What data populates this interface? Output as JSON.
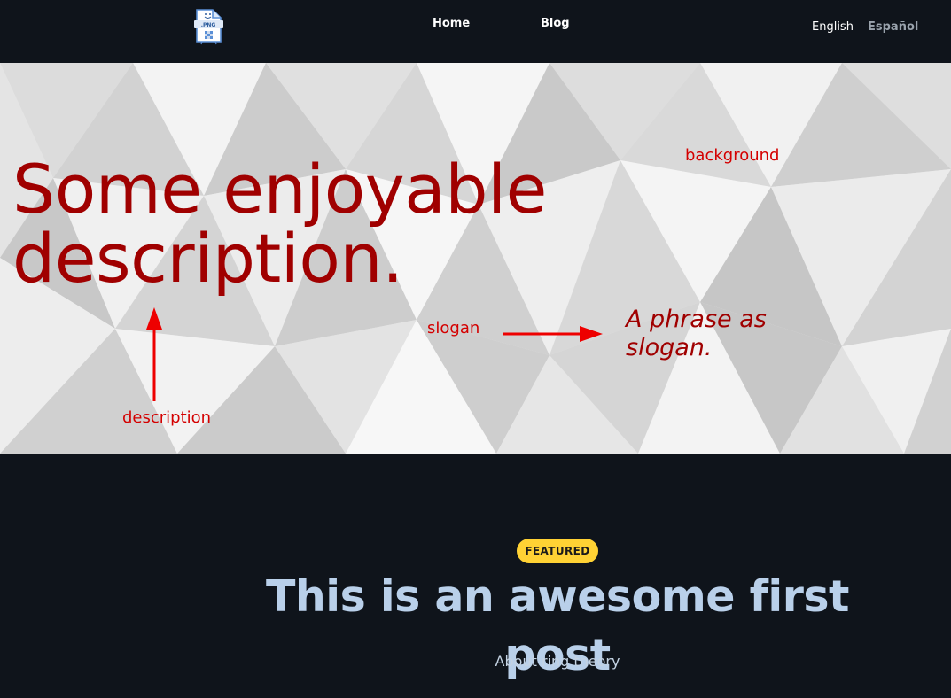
{
  "nav": {
    "logo_text": ".PNG",
    "home_label": "Home",
    "blog_label": "Blog",
    "lang_en": "English",
    "lang_es": "Español"
  },
  "hero": {
    "description": "Some enjoyable description.",
    "slogan": "A phrase as slogan.",
    "annotations": {
      "background": "background",
      "slogan": "slogan",
      "description": "description"
    },
    "text_color": "#a00000",
    "annotation_color": "#d40000"
  },
  "featured": {
    "badge": "FEATURED",
    "title": "This is an awesome first post",
    "subtitle": "About ring theory",
    "badge_color": "#ffd234"
  },
  "colors": {
    "page_bg": "#0f141b",
    "title": "#b9d0ea"
  }
}
